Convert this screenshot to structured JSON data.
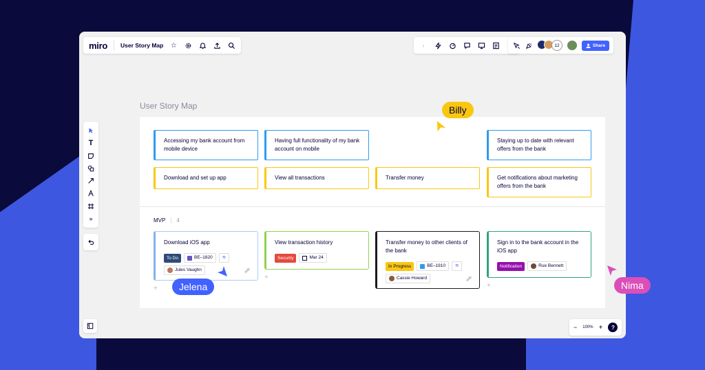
{
  "colors": {
    "brand_blue": "#4262ff",
    "epic_blue": "#2d9bf0",
    "task_yellow": "#fac710",
    "mvp_blue": "#7fb2f0",
    "mvp_green": "#8fd14f",
    "mvp_dark": "#1a1a1a",
    "mvp_teal": "#2ea37f",
    "billy": "#fac710",
    "jelena": "#4262ff",
    "nima": "#da4fb8"
  },
  "header": {
    "logo": "miro",
    "board_title": "User Story Map",
    "share_label": "Share",
    "collaborator_count": "12"
  },
  "zoom": {
    "level": "100%",
    "minus": "−",
    "plus": "+",
    "help": "?"
  },
  "story_map": {
    "title": "User Story Map",
    "epics": [
      "Accessing my bank account from mobile device",
      "Having full functionality of my bank account on mobile",
      "Staying up to date with relevant offers from the bank"
    ],
    "tasks": [
      "Download and set up app",
      "View all transactions",
      "Transfer money",
      "Get notifications about marketing offers from the bank"
    ],
    "mvp": {
      "label": "MVP",
      "count": "4"
    },
    "cards": [
      {
        "title": "Download iOS app",
        "status": "To Do",
        "ticket": "BE–1820",
        "assignee": "Jules Vaughn"
      },
      {
        "title": "View transaction history",
        "status": "Security",
        "date": "Mar 24"
      },
      {
        "title": "Transfer money to other clients of the bank",
        "status": "In Progress",
        "ticket": "BE–1910",
        "assignee": "Cassie Howard"
      },
      {
        "title": "Sign in to the bank account in the iOS app",
        "status": "Notification",
        "assignee": "Rue Bennett"
      }
    ]
  },
  "cursors": {
    "billy": "Billy",
    "jelena": "Jelena",
    "nima": "Nima"
  }
}
